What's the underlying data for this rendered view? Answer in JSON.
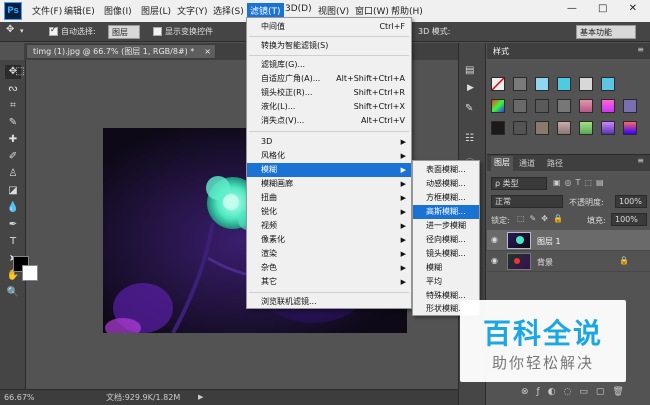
{
  "app": {
    "logo": "Ps"
  },
  "menubar": {
    "items": [
      "文件(F)",
      "编辑(E)",
      "图像(I)",
      "图层(L)",
      "文字(Y)",
      "选择(S)",
      "滤镜(T)",
      "3D(D)",
      "视图(V)",
      "窗口(W)",
      "帮助(H)"
    ],
    "active_index": 6,
    "window_controls": "— □ ✕"
  },
  "options": {
    "auto_select_label": "自动选择:",
    "auto_select_value": "图层",
    "transform_label": "显示变换控件",
    "mode_3d": "3D 模式:",
    "workspace": "基本功能"
  },
  "document": {
    "tab_title": "timg (1).jpg @ 66.7% (图层 1, RGB/8#) *",
    "close": "×"
  },
  "status": {
    "zoom": "66.67%",
    "doc_info": "文档:929.9K/1.82M"
  },
  "filter_menu": {
    "items": [
      {
        "label": "中间值",
        "shortcut": "Ctrl+F"
      },
      {
        "label": "转换为智能滤镜(S)",
        "shortcut": ""
      },
      {
        "label": "滤镜库(G)...",
        "shortcut": ""
      },
      {
        "label": "自适应广角(A)...",
        "shortcut": "Alt+Shift+Ctrl+A"
      },
      {
        "label": "镜头校正(R)...",
        "shortcut": "Shift+Ctrl+R"
      },
      {
        "label": "液化(L)...",
        "shortcut": "Shift+Ctrl+X"
      },
      {
        "label": "消失点(V)...",
        "shortcut": "Alt+Ctrl+V"
      },
      {
        "label": "3D",
        "shortcut": ""
      },
      {
        "label": "风格化",
        "shortcut": ""
      },
      {
        "label": "模糊",
        "shortcut": ""
      },
      {
        "label": "模糊画廊",
        "shortcut": ""
      },
      {
        "label": "扭曲",
        "shortcut": ""
      },
      {
        "label": "锐化",
        "shortcut": ""
      },
      {
        "label": "视频",
        "shortcut": ""
      },
      {
        "label": "像素化",
        "shortcut": ""
      },
      {
        "label": "渲染",
        "shortcut": ""
      },
      {
        "label": "杂色",
        "shortcut": ""
      },
      {
        "label": "其它",
        "shortcut": ""
      },
      {
        "label": "浏览联机滤镜...",
        "shortcut": ""
      }
    ],
    "highlighted": "模糊"
  },
  "blur_submenu": {
    "items": [
      "表面模糊...",
      "动感模糊...",
      "方框模糊...",
      "高斯模糊...",
      "进一步模糊",
      "径向模糊...",
      "镜头模糊...",
      "模糊",
      "平均",
      "特殊模糊...",
      "形状模糊..."
    ],
    "highlighted": "高斯模糊..."
  },
  "styles_panel": {
    "title": "样式"
  },
  "layers_panel": {
    "tabs": [
      "图层",
      "通道",
      "路径"
    ],
    "kind": "ρ 类型",
    "blend_mode": "正常",
    "opacity_label": "不透明度:",
    "opacity_value": "100%",
    "lock_label": "锁定:",
    "fill_label": "填充:",
    "fill_value": "100%",
    "layers": [
      {
        "name": "图层 1",
        "selected": true
      },
      {
        "name": "背景",
        "selected": false
      }
    ]
  },
  "watermark": {
    "title": "百科全说",
    "subtitle": "助你轻松解决"
  },
  "colors": {
    "accent": "#1a72d4",
    "watermark_blue": "#1ba7e1",
    "canvas_flower": "#4de8c0"
  }
}
